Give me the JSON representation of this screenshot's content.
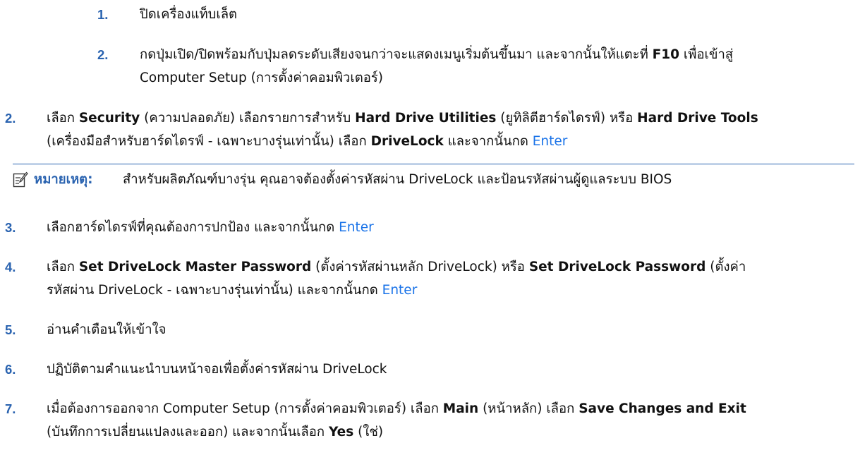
{
  "steps": {
    "sub1": {
      "num": "1.",
      "text": "ปิดเครื่องแท็บเล็ต"
    },
    "sub2": {
      "num": "2.",
      "line1": "กดปุ่มเปิด/ปิดพร้อมกับปุ่มลดระดับเสียงจนกว่าจะแสดงเมนูเริ่มต้นขึ้นมา และจากนั้นให้แตะที่ ",
      "key": "F10",
      "line1_end": " เพื่อเข้าสู่",
      "line2": "Computer Setup (การตั้งค่าคอมพิวเตอร์)"
    },
    "s2": {
      "num": "2.",
      "t1": "เลือก ",
      "b1": "Security",
      "t2": " (ความปลอดภัย) เลือกรายการสำหรับ ",
      "b2": "Hard Drive Utilities",
      "t3": " (ยูทิลิตีฮาร์ดไดรฟ์) หรือ ",
      "b3": "Hard Drive Tools",
      "t4": "(เครื่องมือสำหรับฮาร์ดไดรฟ์ - เฉพาะบางรุ่นเท่านั้น) เลือก ",
      "b4": "DriveLock",
      "t5": " และจากนั้นกด ",
      "link": "Enter"
    },
    "note": {
      "label": "หมายเหตุ:",
      "text": "สำหรับผลิตภัณฑ์บางรุ่น คุณอาจต้องตั้งค่ารหัสผ่าน DriveLock และป้อนรหัสผ่านผู้ดูแลระบบ BIOS"
    },
    "s3": {
      "num": "3.",
      "t1": "เลือกฮาร์ดไดรฟ์ที่คุณต้องการปกป้อง และจากนั้นกด ",
      "link": "Enter"
    },
    "s4": {
      "num": "4.",
      "t1": "เลือก ",
      "b1": "Set DriveLock Master Password",
      "t2": " (ตั้งค่ารหัสผ่านหลัก DriveLock) หรือ ",
      "b2": "Set DriveLock Password",
      "t3": " (ตั้งค่า",
      "t4": "รหัสผ่าน DriveLock - เฉพาะบางรุ่นเท่านั้น) และจากนั้นกด ",
      "link": "Enter"
    },
    "s5": {
      "num": "5.",
      "text": "อ่านคำเตือนให้เข้าใจ"
    },
    "s6": {
      "num": "6.",
      "text": "ปฏิบัติตามคำแนะนำบนหน้าจอเพื่อตั้งค่ารหัสผ่าน DriveLock"
    },
    "s7": {
      "num": "7.",
      "t1": "เมื่อต้องการออกจาก Computer Setup (การตั้งค่าคอมพิวเตอร์) เลือก ",
      "b1": "Main",
      "t2": " (หน้าหลัก) เลือก ",
      "b2": "Save Changes and Exit",
      "t3": "(บันทึกการเปลี่ยนแปลงและออก) และจากนั้นเลือก ",
      "b3": "Yes",
      "t4": " (ใช่)"
    }
  },
  "colors": {
    "accent": "#2a63b0",
    "link": "#1a73e8",
    "text": "#111111"
  },
  "icons": {
    "note": "note-pencil-icon"
  }
}
